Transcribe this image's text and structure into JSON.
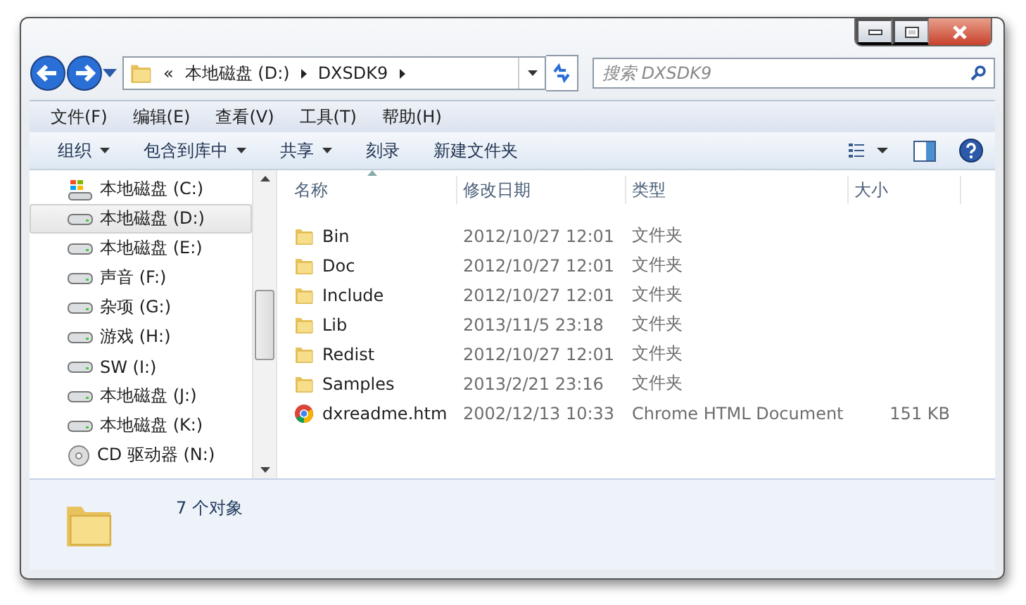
{
  "address": {
    "overflow": "«",
    "crumbs": [
      "本地磁盘 (D:)",
      "DXSDK9"
    ]
  },
  "search": {
    "placeholder": "搜索 DXSDK9"
  },
  "menu": [
    "文件(F)",
    "编辑(E)",
    "查看(V)",
    "工具(T)",
    "帮助(H)"
  ],
  "toolbar": [
    {
      "label": "组织",
      "dropdown": true
    },
    {
      "label": "包含到库中",
      "dropdown": true
    },
    {
      "label": "共享",
      "dropdown": true
    },
    {
      "label": "刻录",
      "dropdown": false
    },
    {
      "label": "新建文件夹",
      "dropdown": false
    }
  ],
  "sidebar": {
    "items": [
      {
        "label": "本地磁盘 (C:)",
        "kind": "system",
        "selected": false
      },
      {
        "label": "本地磁盘 (D:)",
        "kind": "drive",
        "selected": true
      },
      {
        "label": "本地磁盘 (E:)",
        "kind": "drive",
        "selected": false
      },
      {
        "label": "声音 (F:)",
        "kind": "drive",
        "selected": false
      },
      {
        "label": "杂项 (G:)",
        "kind": "drive",
        "selected": false
      },
      {
        "label": "游戏 (H:)",
        "kind": "drive",
        "selected": false
      },
      {
        "label": "SW (I:)",
        "kind": "drive",
        "selected": false
      },
      {
        "label": "本地磁盘 (J:)",
        "kind": "drive",
        "selected": false
      },
      {
        "label": "本地磁盘 (K:)",
        "kind": "drive",
        "selected": false
      },
      {
        "label": "CD 驱动器 (N:)",
        "kind": "cd",
        "selected": false
      }
    ]
  },
  "table": {
    "columns": [
      "名称",
      "修改日期",
      "类型",
      "大小"
    ],
    "rows": [
      {
        "name": "Bin",
        "date": "2012/10/27 12:01",
        "type": "文件夹",
        "kind": "folder"
      },
      {
        "name": "Doc",
        "date": "2012/10/27 12:01",
        "type": "文件夹",
        "kind": "folder"
      },
      {
        "name": "Include",
        "date": "2012/10/27 12:01",
        "type": "文件夹",
        "kind": "folder"
      },
      {
        "name": "Lib",
        "date": "2013/11/5 23:18",
        "type": "文件夹",
        "kind": "folder"
      },
      {
        "name": "Redist",
        "date": "2012/10/27 12:01",
        "type": "文件夹",
        "kind": "folder"
      },
      {
        "name": "Samples",
        "date": "2013/2/21 23:16",
        "type": "文件夹",
        "kind": "folder"
      },
      {
        "name": "dxreadme.htm",
        "date": "2002/12/13 10:33",
        "type": "Chrome HTML Document",
        "size": "151 KB",
        "kind": "chrome"
      }
    ]
  },
  "status_bar": {
    "text": "7 个对象"
  }
}
